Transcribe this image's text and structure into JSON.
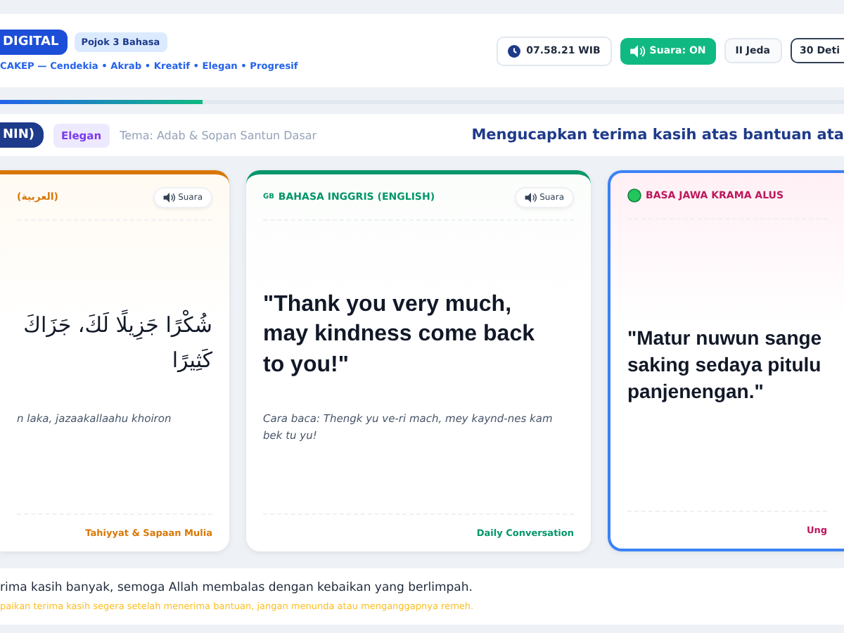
{
  "header": {
    "brand": "DIGITAL",
    "badge": "Pojok 3 Bahasa",
    "tagline": "CAKEP — Cendekia • Akrab • Kreatif • Elegan • Progresif",
    "clock": "07.58.21 WIB",
    "sound_button": {
      "label": "Suara: ON",
      "on": true
    },
    "pause_button": {
      "label": "Jeda",
      "icon": "II"
    },
    "timer_button": "30 Deti"
  },
  "progress": {
    "level": 0.24
  },
  "topic_bar": {
    "session": "NIN)",
    "style_tag": "Elegan",
    "theme": "Tema: Adab & Sopan Santun Dasar",
    "title": "Mengucapkan terima kasih atas bantuan ata"
  },
  "cards": [
    {
      "kind": "arabic",
      "label": "(العربية)",
      "color": "#d97706",
      "selected": false,
      "sound": "Suara",
      "quote": "شُكْرًا جَزِيلًا لَكَ، جَزَاكَ\nكَثِيرًا",
      "reading": "n laka, jazaakallaahu khoiron",
      "footer": "Tahiyyat & Sapaan Mulia"
    },
    {
      "kind": "latin",
      "flag": "GB",
      "label": "BAHASA INGGRIS (ENGLISH)",
      "color": "#059669",
      "selected": false,
      "sound": "Suara",
      "quote": "\"Thank you very much,\nmay kindness come back\nto you!\"",
      "reading": "Cara baca: Thengk yu ve-ri mach, mey kaynd-nes kam bek tu yu!",
      "footer": "Daily Conversation"
    },
    {
      "kind": "latin",
      "label": "BASA JAWA KRAMA ALUS",
      "color": "#be185d",
      "selected": true,
      "quote": "\"Matur nuwun sange\nsaking sedaya pitulu\npanjenengan.\"",
      "footer": "Ung"
    }
  ],
  "meaning": {
    "text": "rima kasih banyak, semoga Allah membalas dengan kebaikan yang berlimpah.",
    "tip": "paikan terima kasih segera setelah menerima bantuan, jangan menunda atau menganggapnya remeh."
  }
}
